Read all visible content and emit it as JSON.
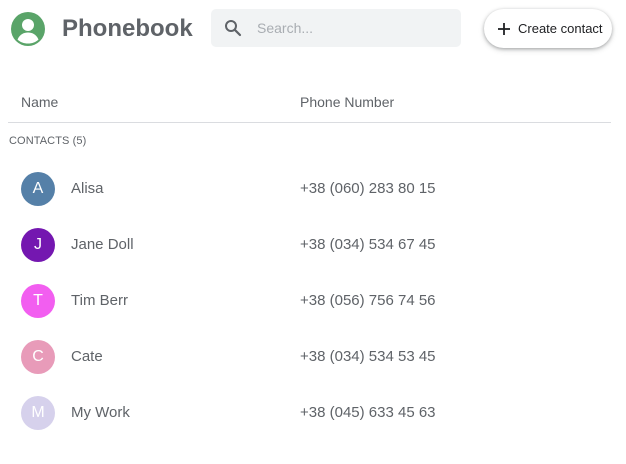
{
  "header": {
    "title": "Phonebook",
    "logo_icon": "account-circle-icon",
    "logo_color": "#5aa469"
  },
  "search": {
    "placeholder": "Search...",
    "value": "",
    "icon": "search-icon"
  },
  "create_button": {
    "label": "Create contact",
    "icon": "plus-icon"
  },
  "table": {
    "columns": [
      "Name",
      "Phone Number"
    ],
    "section_label": "CONTACTS (5)"
  },
  "contacts": [
    {
      "initial": "A",
      "name": "Alisa",
      "phone": "+38 (060) 283 80 15",
      "color": "#5580a8"
    },
    {
      "initial": "J",
      "name": "Jane Doll",
      "phone": "+38 (034) 534 67 45",
      "color": "#7417b0"
    },
    {
      "initial": "T",
      "name": "Tim Berr",
      "phone": "+38 (056) 756 74 56",
      "color": "#f25ef0"
    },
    {
      "initial": "C",
      "name": "Cate",
      "phone": "+38 (034) 534 53 45",
      "color": "#e89bb9"
    },
    {
      "initial": "M",
      "name": "My Work",
      "phone": "+38 (045) 633 45 63",
      "color": "#d6d1ec"
    }
  ]
}
